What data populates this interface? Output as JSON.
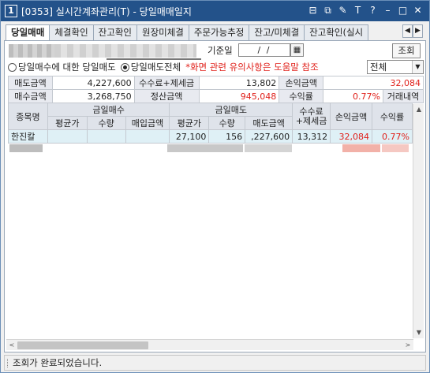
{
  "window": {
    "screen_number": "1",
    "title": "[0353] 실시간계좌관리(T) - 당일매매일지",
    "controls": [
      "layout-icon",
      "copy-icon",
      "pin-icon",
      "font-icon",
      "help-icon",
      "minimize-icon",
      "maximize-icon",
      "close-icon"
    ],
    "control_glyphs": [
      "⊟",
      "⧉",
      "✎",
      "T",
      "?",
      "–",
      "□",
      "✕"
    ]
  },
  "tabs": [
    {
      "label": "당일매매",
      "active": true
    },
    {
      "label": "체결확인",
      "active": false
    },
    {
      "label": "잔고확인",
      "active": false
    },
    {
      "label": "원장미체결",
      "active": false
    },
    {
      "label": "주문가능추정",
      "active": false
    },
    {
      "label": "잔고/미체결",
      "active": false
    },
    {
      "label": "잔고확인(실시",
      "active": false
    }
  ],
  "tab_arrows": [
    "◀",
    "▶"
  ],
  "filter": {
    "date_label": "기준일",
    "date_value": "/ /",
    "calendar_glyph": "▦",
    "query_button": "조회",
    "radio_buy_label": "당일매수에 대한 당일매도",
    "radio_sell_label": "당일매도전체",
    "selected_radio": "sell",
    "notice": "*화면 관련 유의사항은 도움말 참조",
    "select_value": "전체",
    "select_arrow": "▼"
  },
  "summary": {
    "sell_amount_label": "매도금액",
    "sell_amount": "4,227,600",
    "fee_tax_label": "수수료+제세금",
    "fee_tax": "13,802",
    "pnl_label": "손익금액",
    "pnl": "32,084",
    "buy_amount_label": "매수금액",
    "buy_amount": "3,268,750",
    "settle_label": "정산금액",
    "settle": "945,048",
    "return_label": "수익률",
    "return": "0.77%",
    "history_label": "거래내역"
  },
  "grid": {
    "headers": {
      "stock": "종목명",
      "buy_group": "금일매수",
      "sell_group": "금일매도",
      "fee": "수수료\n+제세금",
      "pnl": "손익금액",
      "return": "수익률",
      "buy_avg": "평균가",
      "buy_qty": "수량",
      "buy_amount": "매입금액",
      "sell_avg": "평균가",
      "sell_qty": "수량",
      "sell_amount": "매도금액"
    },
    "rows": [
      {
        "stock": "한진칼",
        "buy_avg": "",
        "buy_qty": "",
        "buy_amount": "",
        "sell_avg": "27,100",
        "sell_qty": "156",
        "sell_amount": ",227,600",
        "fee": "13,312",
        "pnl": "32,084",
        "return": "0.77%"
      }
    ]
  },
  "scroll": {
    "up": "▲",
    "down": "▼",
    "left": "<",
    "right": ">"
  },
  "status": {
    "message": "조회가 완료되었습니다."
  },
  "colors": {
    "title_bg": "#23528a",
    "accent_red": "#e0201a",
    "row_highlight": "#dff0f6"
  }
}
